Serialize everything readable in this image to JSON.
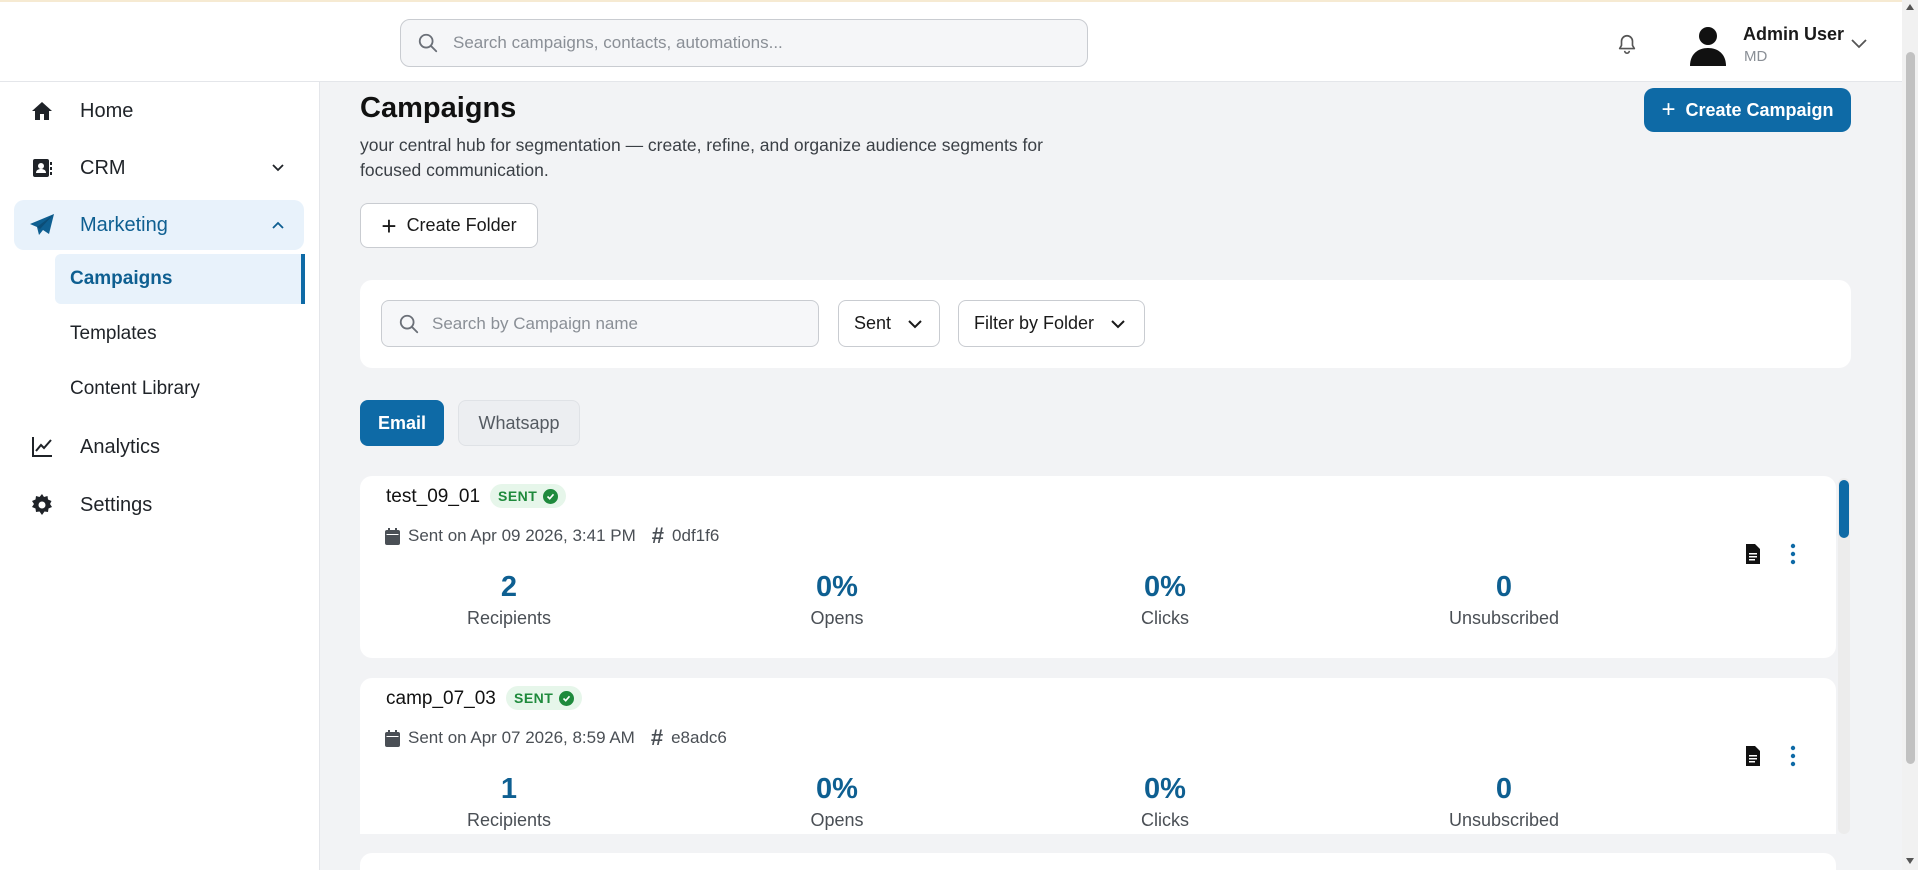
{
  "topbar": {
    "search_placeholder": "Search campaigns, contacts, automations...",
    "user_name": "Admin User",
    "user_role": "MD"
  },
  "sidebar": {
    "items": [
      {
        "label": "Home",
        "icon": "home-icon"
      },
      {
        "label": "CRM",
        "icon": "contacts-icon"
      },
      {
        "label": "Marketing",
        "icon": "paper-plane-icon"
      },
      {
        "label": "Analytics",
        "icon": "line-chart-icon"
      },
      {
        "label": "Settings",
        "icon": "gear-icon"
      }
    ],
    "marketing_sub": [
      "Campaigns",
      "Templates",
      "Content Library"
    ]
  },
  "main": {
    "title": "Campaigns",
    "description": "your central hub for segmentation — create, refine, and organize audience segments for focused communication.",
    "create_campaign_label": "Create Campaign",
    "create_folder_label": "Create Folder",
    "filters": {
      "search_placeholder": "Search by Campaign name",
      "status_value": "Sent",
      "folder_value": "Filter by Folder"
    },
    "tabs": [
      "Email",
      "Whatsapp"
    ],
    "active_tab": "Email"
  },
  "campaigns": [
    {
      "name": "test_09_01",
      "status": "SENT",
      "sent_on": "Sent on Apr 09 2026, 3:41 PM",
      "id": "0df1f6",
      "stats": [
        {
          "value": "2",
          "label": "Recipients"
        },
        {
          "value": "0%",
          "label": "Opens"
        },
        {
          "value": "0%",
          "label": "Clicks"
        },
        {
          "value": "0",
          "label": "Unsubscribed"
        }
      ]
    },
    {
      "name": "camp_07_03",
      "status": "SENT",
      "sent_on": "Sent on Apr 07 2026, 8:59 AM",
      "id": "e8adc6",
      "stats": [
        {
          "value": "1",
          "label": "Recipients"
        },
        {
          "value": "0%",
          "label": "Opens"
        },
        {
          "value": "0%",
          "label": "Clicks"
        },
        {
          "value": "0",
          "label": "Unsubscribed"
        }
      ]
    }
  ],
  "colors": {
    "accent": "#0e6aa6",
    "active_bg": "#e8f2fb",
    "status_green": "#1e8a3c",
    "page_bg": "#f2f3f5"
  }
}
